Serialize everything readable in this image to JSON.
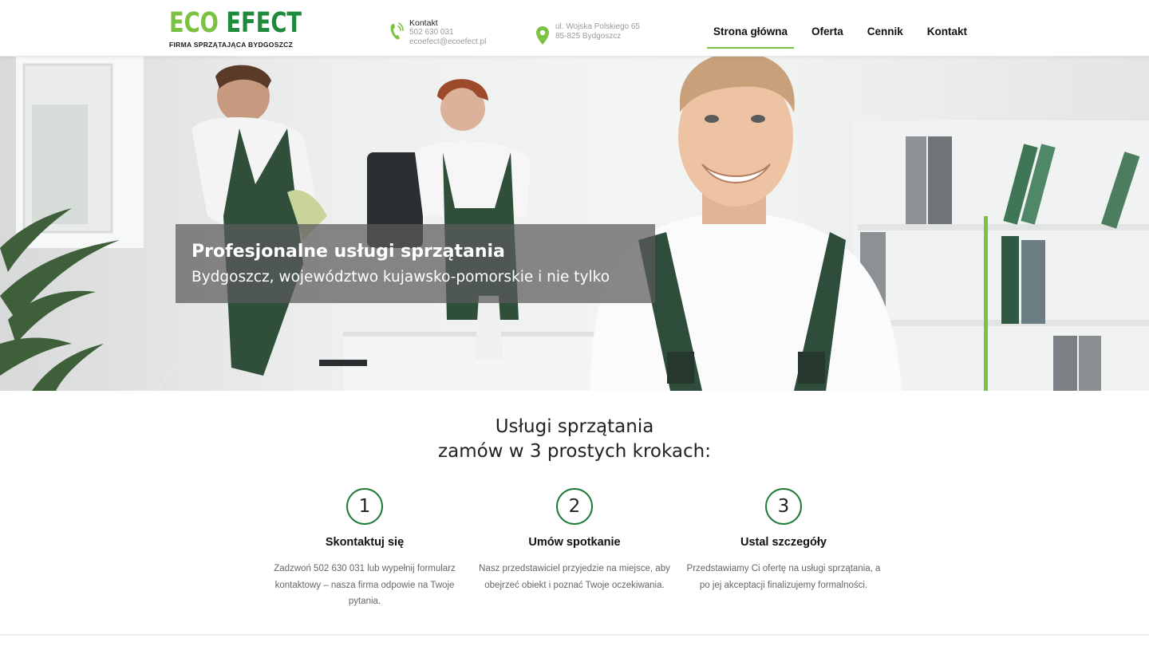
{
  "brand": {
    "logo_eco": "ECO",
    "logo_efect": "EFECT",
    "tagline": "FIRMA SPRZĄTAJĄCA BYDGOSZCZ",
    "colors": {
      "light_green": "#7cc242",
      "dark_green": "#1f8a3c",
      "circle_border": "#1f7a3a"
    }
  },
  "contact": {
    "icon": "phone-icon",
    "title": "Kontakt",
    "phone": "502 630 031",
    "email": "ecoefect@ecoefect.pl"
  },
  "address": {
    "icon": "map-pin-icon",
    "line1": "ul. Wojska Polskiego 65",
    "line2": "85-825 Bydgoszcz"
  },
  "nav": {
    "items": [
      {
        "label": "Strona główna",
        "active": true
      },
      {
        "label": "Oferta",
        "active": false
      },
      {
        "label": "Cennik",
        "active": false
      },
      {
        "label": "Kontakt",
        "active": false
      }
    ]
  },
  "hero": {
    "title": "Profesjonalne usługi sprzątania",
    "subtitle": "Bydgoszcz, województwo kujawsko-pomorskie i nie tylko"
  },
  "steps_section": {
    "title_line1": "Usługi sprzątania",
    "title_line2": "zamów w 3 prostych krokach:",
    "steps": [
      {
        "number": "1",
        "title": "Skontaktuj się",
        "text": "Zadzwoń 502 630 031 lub wypełnij formularz kontaktowy – nasza firma odpowie na Twoje pytania."
      },
      {
        "number": "2",
        "title": "Umów spotkanie",
        "text": "Nasz przedstawiciel przyjedzie na miejsce, aby obejrzeć obiekt i poznać Twoje oczekiwania."
      },
      {
        "number": "3",
        "title": "Ustal szczegóły",
        "text": "Przedstawiamy Ci ofertę na usługi sprzątania, a po jej akceptacji finalizujemy formalności."
      }
    ]
  }
}
